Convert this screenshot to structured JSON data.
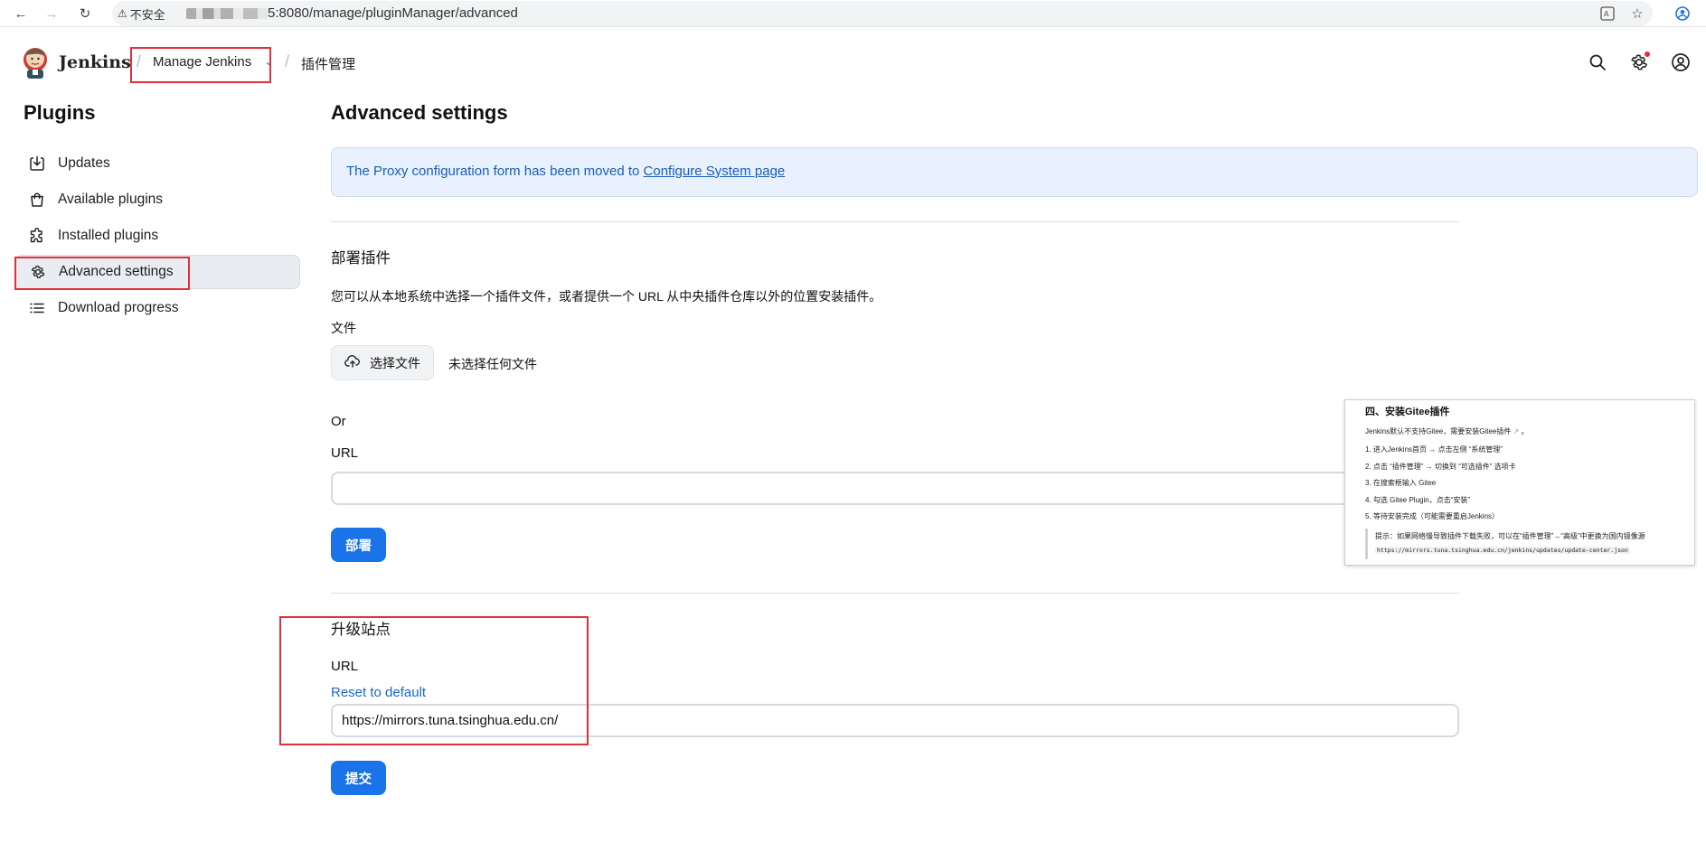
{
  "browser": {
    "security_label": "不安全",
    "url": "5:8080/manage/pluginManager/advanced"
  },
  "header": {
    "brand": "Jenkins",
    "breadcrumb": [
      "Manage Jenkins",
      "插件管理"
    ]
  },
  "sidebar": {
    "title": "Plugins",
    "items": [
      {
        "label": "Updates",
        "icon": "download-icon"
      },
      {
        "label": "Available plugins",
        "icon": "shopping-bag-icon"
      },
      {
        "label": "Installed plugins",
        "icon": "puzzle-icon"
      },
      {
        "label": "Advanced settings",
        "icon": "gear-icon",
        "active": true
      },
      {
        "label": "Download progress",
        "icon": "list-icon"
      }
    ]
  },
  "main": {
    "title": "Advanced settings",
    "notice_text": "The Proxy configuration form has been moved to ",
    "notice_link": "Configure System page",
    "deploy": {
      "heading": "部署插件",
      "description": "您可以从本地系统中选择一个插件文件，或者提供一个 URL 从中央插件仓库以外的位置安装插件。",
      "file_label": "文件",
      "file_button": "选择文件",
      "file_status": "未选择任何文件",
      "or_label": "Or",
      "url_label": "URL",
      "url_value": "",
      "submit": "部署"
    },
    "update_site": {
      "heading": "升级站点",
      "url_label": "URL",
      "reset_link": "Reset to default",
      "url_value": "https://mirrors.tuna.tsinghua.edu.cn/",
      "submit": "提交"
    }
  },
  "overlay_doc": {
    "heading": "四、安装Gitee插件",
    "intro": "Jenkins默认不支持Gitee，需要安装Gitee插件",
    "steps": [
      "1. 进入Jenkins首页 → 点击左侧 “系统管理”",
      "2. 点击 “插件管理” → 切换到 “可选插件” 选项卡",
      "3. 在搜索框输入 Gitee",
      "4. 勾选 Gitee Plugin，点击“安装”",
      "5. 等待安装完成（可能需要重启Jenkins）"
    ],
    "tip": "提示：如果网络慢导致插件下载失败，可以在“插件管理”→“高级”中更换为国内镜像源",
    "tip_url": "https://mirrors.tuna.tsinghua.edu.cn/jenkins/updates/update-center.json"
  },
  "colors": {
    "primary": "#1a73e8",
    "notice_bg": "#e8f1fd",
    "annotation_red": "#e0303a"
  }
}
